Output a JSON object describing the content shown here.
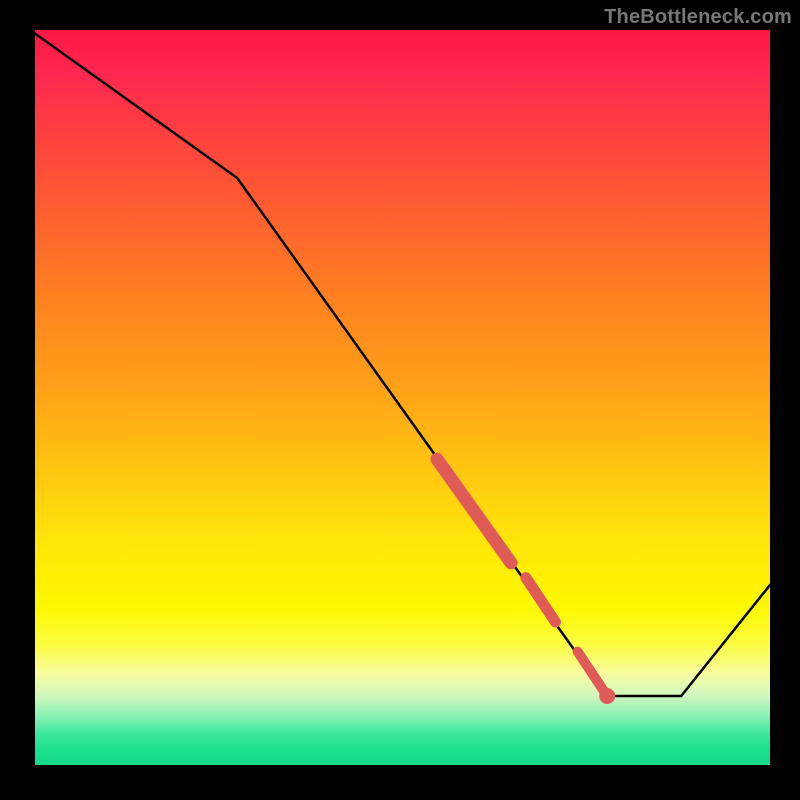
{
  "watermark": "TheBottleneck.com",
  "chart_data": {
    "type": "line",
    "title": "",
    "xlabel": "",
    "ylabel": "",
    "xlim": [
      0,
      100
    ],
    "ylim": [
      0,
      100
    ],
    "grid": false,
    "legend": false,
    "background": "vertical-gradient-red-to-green",
    "series": [
      {
        "name": "bottleneck-curve",
        "color": "#000000",
        "style": "line",
        "x": [
          0,
          28,
          78,
          88,
          100
        ],
        "values": [
          100,
          80,
          10,
          10,
          25
        ]
      },
      {
        "name": "highlighted-segment",
        "color": "#e05a57",
        "style": "thick-line-with-caps",
        "x": [
          55,
          65,
          67,
          71,
          74,
          78
        ],
        "values": [
          42,
          28,
          26,
          20,
          16,
          10
        ]
      }
    ],
    "annotations": [
      {
        "type": "dot",
        "x": 78,
        "y": 10,
        "color": "#e05a57"
      }
    ]
  }
}
